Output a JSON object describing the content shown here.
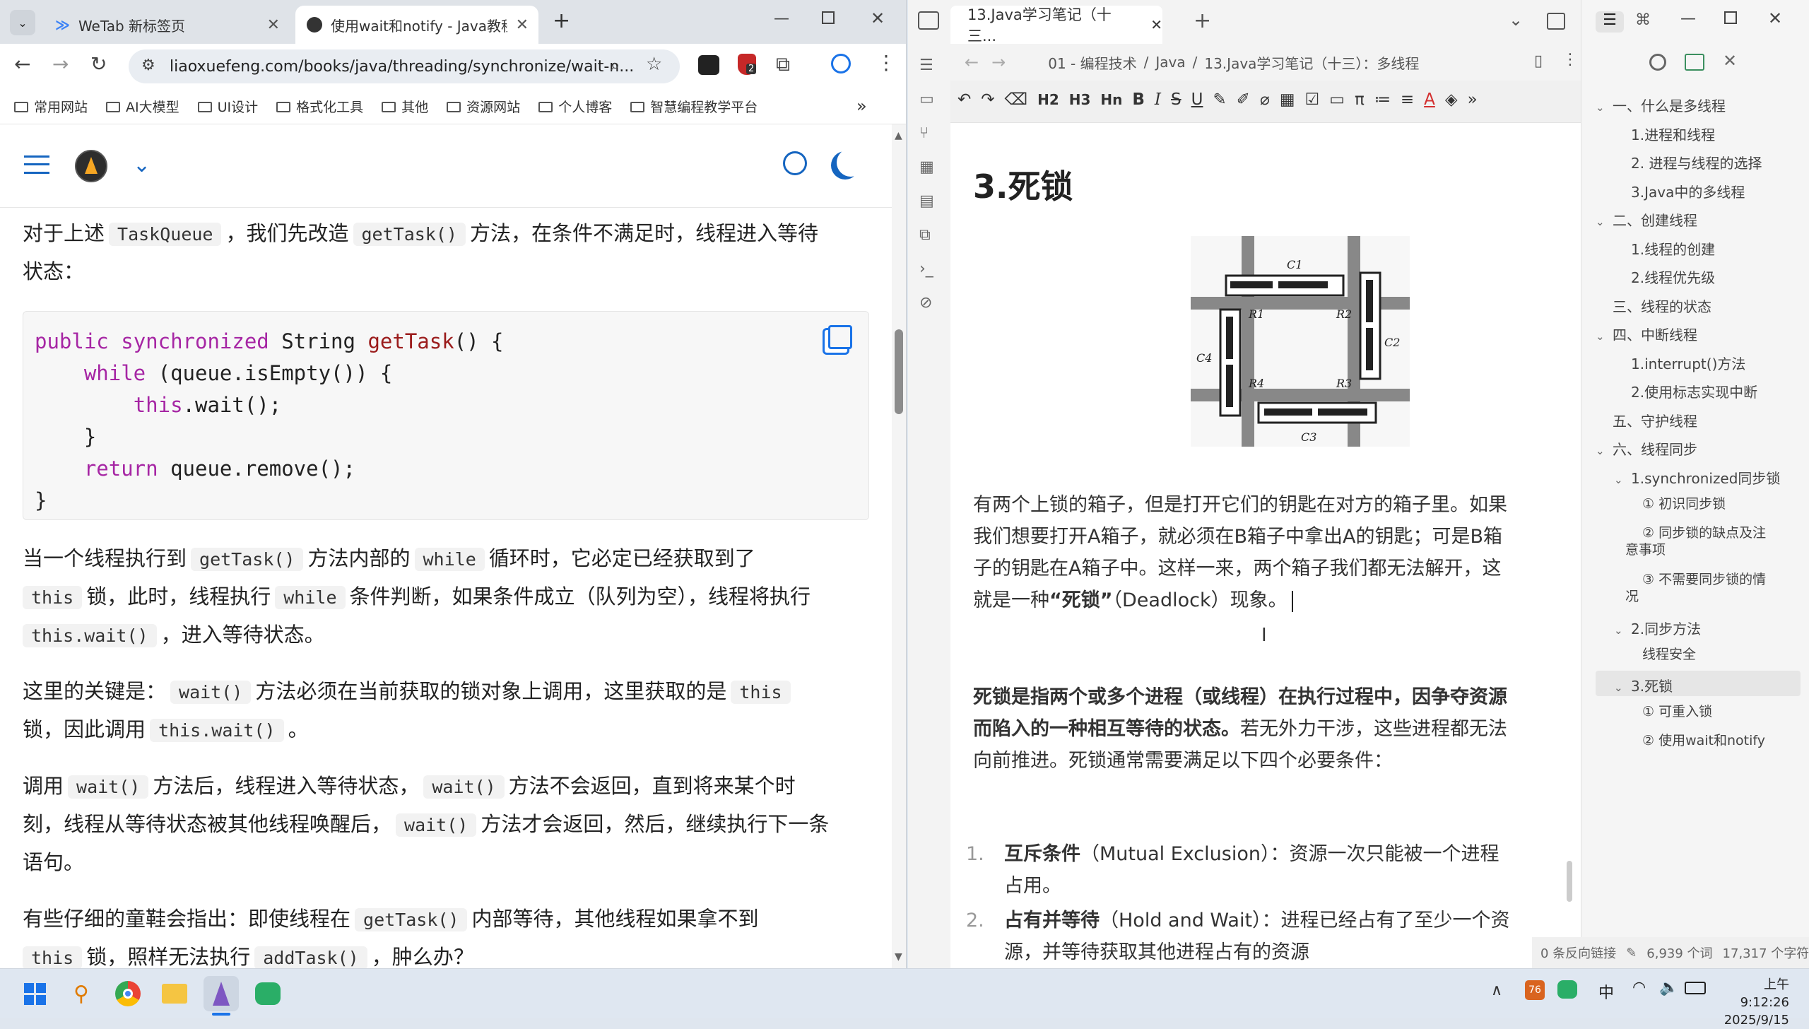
{
  "chrome": {
    "tabs": [
      {
        "title": "WeTab 新标签页",
        "active": false
      },
      {
        "title": "使用wait和notify - Java教程 -",
        "active": true
      }
    ],
    "new_tab": "+",
    "url": "liaoxuefeng.com/books/java/threading/synchronize/wait-n...",
    "bookmarks": [
      "常用网站",
      "AI大模型",
      "UI设计",
      "格式化工具",
      "其他",
      "资源网站",
      "个人博客",
      "智慧编程教学平台"
    ],
    "bookmarks_more": "»",
    "extension_badge": "2"
  },
  "article": {
    "p1_a": "对于上述",
    "p1_code": "TaskQueue",
    "p1_b": "，我们先改造",
    "p1_code2": "getTask()",
    "p1_c": "方法，在条件不满足时，线程进入等待",
    "p1_d": "状态：",
    "code_lines": [
      "public synchronized String getTask() {",
      "    while (queue.isEmpty()) {",
      "        this.wait();",
      "    }",
      "    return queue.remove();",
      "}"
    ],
    "p2_a": "当一个线程执行到",
    "p2_code1": "getTask()",
    "p2_b": "方法内部的",
    "p2_code2": "while",
    "p2_c": "循环时，它必定已经获取到了",
    "p2_code3": "this",
    "p2_d": "锁，此时，线程执行",
    "p2_code4": "while",
    "p2_e": "条件判断，如果条件成立（队列为空），线程将执行",
    "p2_code5": "this.wait()",
    "p2_f": "，进入等待状态。",
    "p3_a": "这里的关键是：",
    "p3_code1": "wait()",
    "p3_b": "方法必须在当前获取的锁对象上调用，这里获取的是",
    "p3_code2": "this",
    "p3_c": "锁，因此调用",
    "p3_code3": "this.wait()",
    "p3_d": "。",
    "p4_a": "调用",
    "p4_code1": "wait()",
    "p4_b": "方法后，线程进入等待状态，",
    "p4_code2": "wait()",
    "p4_c": "方法不会返回，直到将来某个时",
    "p4_d": "刻，线程从等待状态被其他线程唤醒后，",
    "p4_code3": "wait()",
    "p4_e": "方法才会返回，然后，继续执行下一条",
    "p4_f": "语句。",
    "p5_a": "有些仔细的童鞋会指出：即使线程在",
    "p5_code1": "getTask()",
    "p5_b": "内部等待，其他线程如果拿不到",
    "p5_code2": "this",
    "p5_c": "锁，照样无法执行",
    "p5_code3": "addTask()",
    "p5_d": "，肿么办？"
  },
  "typora": {
    "tab_title": "13.Java学习笔记（十三...",
    "breadcrumb": [
      "01 - 编程技术",
      "Java",
      "13.Java学习笔记（十三）：多线程"
    ],
    "breadcrumb_sep": "/",
    "toolbar": [
      "H2",
      "H3",
      "Hn"
    ],
    "heading": "3.死锁",
    "diagram_labels": [
      "C1",
      "C2",
      "C3",
      "C4",
      "R1",
      "R2",
      "R3",
      "R4"
    ],
    "para1": "有两个上锁的箱子，但是打开它们的钥匙在对方的箱子里。如果我们想要打开A箱子，就必须在B箱子中拿出A的钥匙；可是B箱子的钥匙在A箱子中。这样一来，两个箱子我们都无法解开，这就是一种",
    "para1_bold": "“死锁”",
    "para1_end": "（Deadlock）现象。",
    "para2_bold": "死锁是指两个或多个进程（或线程）在执行过程中，因争夺资源而陷入的一种相互等待的状态。",
    "para2_rest": "若无外力干涉，这些进程都无法向前推进。死锁通常需要满足以下四个必要条件：",
    "list": [
      {
        "num": "1.",
        "bold": "互斥条件",
        "en": "（Mutual Exclusion）",
        "text": "：资源一次只能被一个进程占用。"
      },
      {
        "num": "2.",
        "bold": "占有并等待",
        "en": "（Hold and Wait）",
        "text": "：进程已经占有了至少一个资源，并等待获取其他进程占有的资源"
      }
    ],
    "status": {
      "backlinks": "0 条反向链接",
      "words": "6,939 个词",
      "chars": "17,317 个字符"
    }
  },
  "outline": [
    {
      "level": 1,
      "text": "一、什么是多线程",
      "caret": "v"
    },
    {
      "level": 2,
      "text": "1.进程和线程"
    },
    {
      "level": 2,
      "text": "2. 进程与线程的选择"
    },
    {
      "level": 2,
      "text": "3.Java中的多线程"
    },
    {
      "level": 1,
      "text": "二、创建线程",
      "caret": "v"
    },
    {
      "level": 2,
      "text": "1.线程的创建"
    },
    {
      "level": 2,
      "text": "2.线程优先级"
    },
    {
      "level": 1,
      "text": "三、线程的状态"
    },
    {
      "level": 1,
      "text": "四、中断线程",
      "caret": "v"
    },
    {
      "level": 2,
      "text": "1.interrupt()方法"
    },
    {
      "level": 2,
      "text": "2.使用标志实现中断"
    },
    {
      "level": 1,
      "text": "五、守护线程"
    },
    {
      "level": 1,
      "text": "六、线程同步",
      "caret": "v"
    },
    {
      "level": 2,
      "text": "1.synchronized同步锁",
      "caret": "v"
    },
    {
      "level": 3,
      "text": "① 初识同步锁"
    },
    {
      "level": 3,
      "text": "② 同步锁的缺点及注意事项"
    },
    {
      "level": 3,
      "text": "③ 不需要同步锁的情况"
    },
    {
      "level": 2,
      "text": "2.同步方法",
      "caret": "v"
    },
    {
      "level": 3,
      "text": "线程安全"
    },
    {
      "level": 2,
      "text": "3.死锁",
      "caret": "v",
      "active": true
    },
    {
      "level": 3,
      "text": "① 可重入锁"
    },
    {
      "level": 3,
      "text": "② 使用wait和notify"
    }
  ],
  "taskbar": {
    "ime": "中",
    "time": "上午 9:12:26",
    "date": "2025/9/15"
  },
  "colors": {
    "accent": "#1a73e8",
    "site_blue": "#1565c0",
    "keyword": "#a626a4",
    "function": "#9b1c1c"
  }
}
